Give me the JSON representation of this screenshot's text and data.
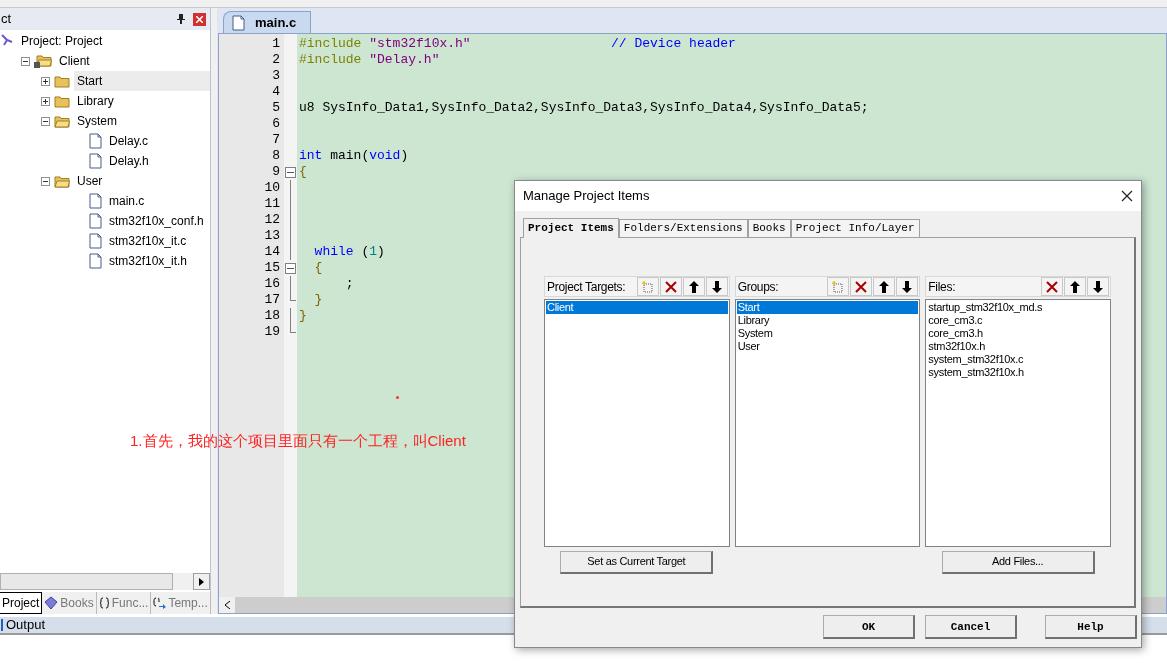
{
  "project_panel": {
    "title": "ct",
    "tree": [
      {
        "label": "Project: Project",
        "kind": "project",
        "selected": false,
        "children": [
          {
            "label": "Client",
            "kind": "target",
            "expanded": true,
            "selected": false,
            "children": [
              {
                "label": "Start",
                "kind": "group",
                "expanded": false,
                "selected": true
              },
              {
                "label": "Library",
                "kind": "group",
                "expanded": false,
                "selected": false
              },
              {
                "label": "System",
                "kind": "group",
                "expanded": true,
                "selected": false,
                "children": [
                  {
                    "label": "Delay.c",
                    "kind": "file",
                    "selected": false
                  },
                  {
                    "label": "Delay.h",
                    "kind": "file",
                    "selected": false
                  }
                ]
              },
              {
                "label": "User",
                "kind": "group",
                "expanded": true,
                "selected": false,
                "children": [
                  {
                    "label": "main.c",
                    "kind": "file",
                    "selected": false
                  },
                  {
                    "label": "stm32f10x_conf.h",
                    "kind": "file",
                    "selected": false
                  },
                  {
                    "label": "stm32f10x_it.c",
                    "kind": "file",
                    "selected": false
                  },
                  {
                    "label": "stm32f10x_it.h",
                    "kind": "file",
                    "selected": false
                  }
                ]
              }
            ]
          }
        ]
      }
    ],
    "tabs": [
      {
        "label": "Project",
        "selected": true
      },
      {
        "label": "Books",
        "selected": false
      },
      {
        "label": "Func...",
        "selected": false
      },
      {
        "label": "Temp...",
        "selected": false
      }
    ]
  },
  "editor": {
    "tab": "main.c",
    "lines": [
      {
        "number": "1",
        "kind": "plain",
        "tokens": [
          {
            "kind": "pre",
            "text": "#include "
          },
          {
            "kind": "string",
            "text": "\"stm32f10x.h\""
          },
          {
            "kind": "comment",
            "text": "                  // Device header"
          }
        ]
      },
      {
        "number": "2",
        "kind": "plain",
        "tokens": [
          {
            "kind": "pre",
            "text": "#include "
          },
          {
            "kind": "string",
            "text": "\"Delay.h\""
          }
        ]
      },
      {
        "number": "3",
        "kind": "plain"
      },
      {
        "number": "4",
        "kind": "plain"
      },
      {
        "number": "5",
        "kind": "plain",
        "tokens": [
          {
            "kind": "plain",
            "text": "u8 SysInfo_Data1,SysInfo_Data2,SysInfo_Data3,SysInfo_Data4,SysInfo_Data5;"
          }
        ]
      },
      {
        "number": "6",
        "kind": "plain"
      },
      {
        "number": "7",
        "kind": "plain"
      },
      {
        "number": "8",
        "kind": "plain",
        "tokens": [
          {
            "kind": "keyword",
            "text": "int"
          },
          {
            "kind": "plain",
            "text": " main("
          },
          {
            "kind": "keyword",
            "text": "void"
          },
          {
            "kind": "plain",
            "text": ")"
          }
        ]
      },
      {
        "number": "9",
        "kind": "foldstart",
        "tokens": [
          {
            "kind": "brace",
            "text": "{"
          }
        ]
      },
      {
        "number": "10",
        "kind": "foldbody"
      },
      {
        "number": "11",
        "kind": "foldbody"
      },
      {
        "number": "12",
        "kind": "foldbody"
      },
      {
        "number": "13",
        "kind": "foldbody"
      },
      {
        "number": "14",
        "kind": "foldbody",
        "tokens": [
          {
            "kind": "keyword",
            "text": "  while"
          },
          {
            "kind": "plain",
            "text": " ("
          },
          {
            "kind": "number",
            "text": "1"
          },
          {
            "kind": "plain",
            "text": ")"
          }
        ]
      },
      {
        "number": "15",
        "kind": "foldstart",
        "tokens": [
          {
            "kind": "brace",
            "text": "  {"
          }
        ]
      },
      {
        "number": "16",
        "kind": "foldbody",
        "tokens": [
          {
            "kind": "plain",
            "text": "      ;"
          }
        ]
      },
      {
        "number": "17",
        "kind": "foldend",
        "tokens": [
          {
            "kind": "brace",
            "text": "  }"
          }
        ]
      },
      {
        "number": "18",
        "kind": "foldbody",
        "tokens": [
          {
            "kind": "brace",
            "text": "}"
          }
        ]
      },
      {
        "number": "19",
        "kind": "foldend"
      }
    ]
  },
  "annotation": "1.首先，我的这个项目里面只有一个工程，叫Client",
  "output_bar": "Output",
  "dialog": {
    "title": "Manage Project Items",
    "tabs": [
      {
        "label": "Project Items",
        "selected": true
      },
      {
        "label": "Folders/Extensions",
        "selected": false
      },
      {
        "label": "Books",
        "selected": false
      },
      {
        "label": "Project Info/Layer",
        "selected": false
      }
    ],
    "lists": [
      {
        "label": "Project Targets:",
        "can_add": true,
        "items": [
          {
            "label": "Client",
            "selected": true
          }
        ],
        "button": "Set as Current Target"
      },
      {
        "label": "Groups:",
        "can_add": true,
        "items": [
          {
            "label": "Start",
            "selected": true
          },
          {
            "label": "Library",
            "selected": false
          },
          {
            "label": "System",
            "selected": false
          },
          {
            "label": "User",
            "selected": false
          }
        ]
      },
      {
        "label": "Files:",
        "can_add": false,
        "items": [
          {
            "label": "startup_stm32f10x_md.s",
            "selected": false
          },
          {
            "label": "core_cm3.c",
            "selected": false
          },
          {
            "label": "core_cm3.h",
            "selected": false
          },
          {
            "label": "stm32f10x.h",
            "selected": false
          },
          {
            "label": "system_stm32f10x.c",
            "selected": false
          },
          {
            "label": "system_stm32f10x.h",
            "selected": false
          }
        ],
        "button": "Add Files..."
      }
    ],
    "buttons": [
      "OK",
      "Cancel",
      "Help"
    ]
  }
}
